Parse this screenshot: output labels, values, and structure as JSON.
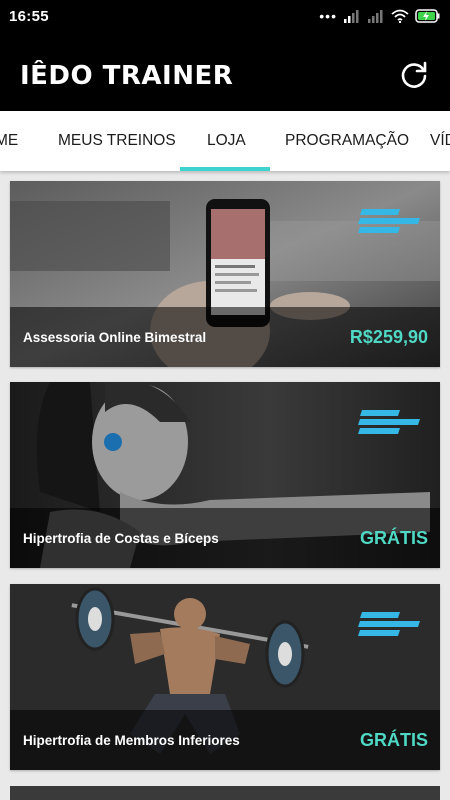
{
  "status_bar": {
    "time": "16:55",
    "icons": [
      "more-dots-icon",
      "signal-icon",
      "signal-icon",
      "wifi-icon",
      "battery-charging-icon"
    ]
  },
  "app_bar": {
    "title": "IÊDO TRAINER",
    "refresh_icon": "refresh-icon"
  },
  "tabs": [
    {
      "label": "ME"
    },
    {
      "label": "MEUS TREINOS"
    },
    {
      "label": "LOJA",
      "selected": true
    },
    {
      "label": "PROGRAMAÇÃO"
    },
    {
      "label": "VÍD"
    }
  ],
  "products": [
    {
      "title": "Assessoria Online Bimestral",
      "price": "R$259,90",
      "image": "hand-holding-phone"
    },
    {
      "title": "Hipertrofia de Costas e Bíceps",
      "price": "GRÁTIS",
      "image": "woman-stretching"
    },
    {
      "title": "Hipertrofia de Membros Inferiores",
      "price": "GRÁTIS",
      "image": "man-squat-barbell"
    }
  ],
  "colors": {
    "accent": "#3fd3cf",
    "price": "#4fd8c4",
    "brand_stripes": "#35b8e6",
    "app_bar": "#000000"
  }
}
